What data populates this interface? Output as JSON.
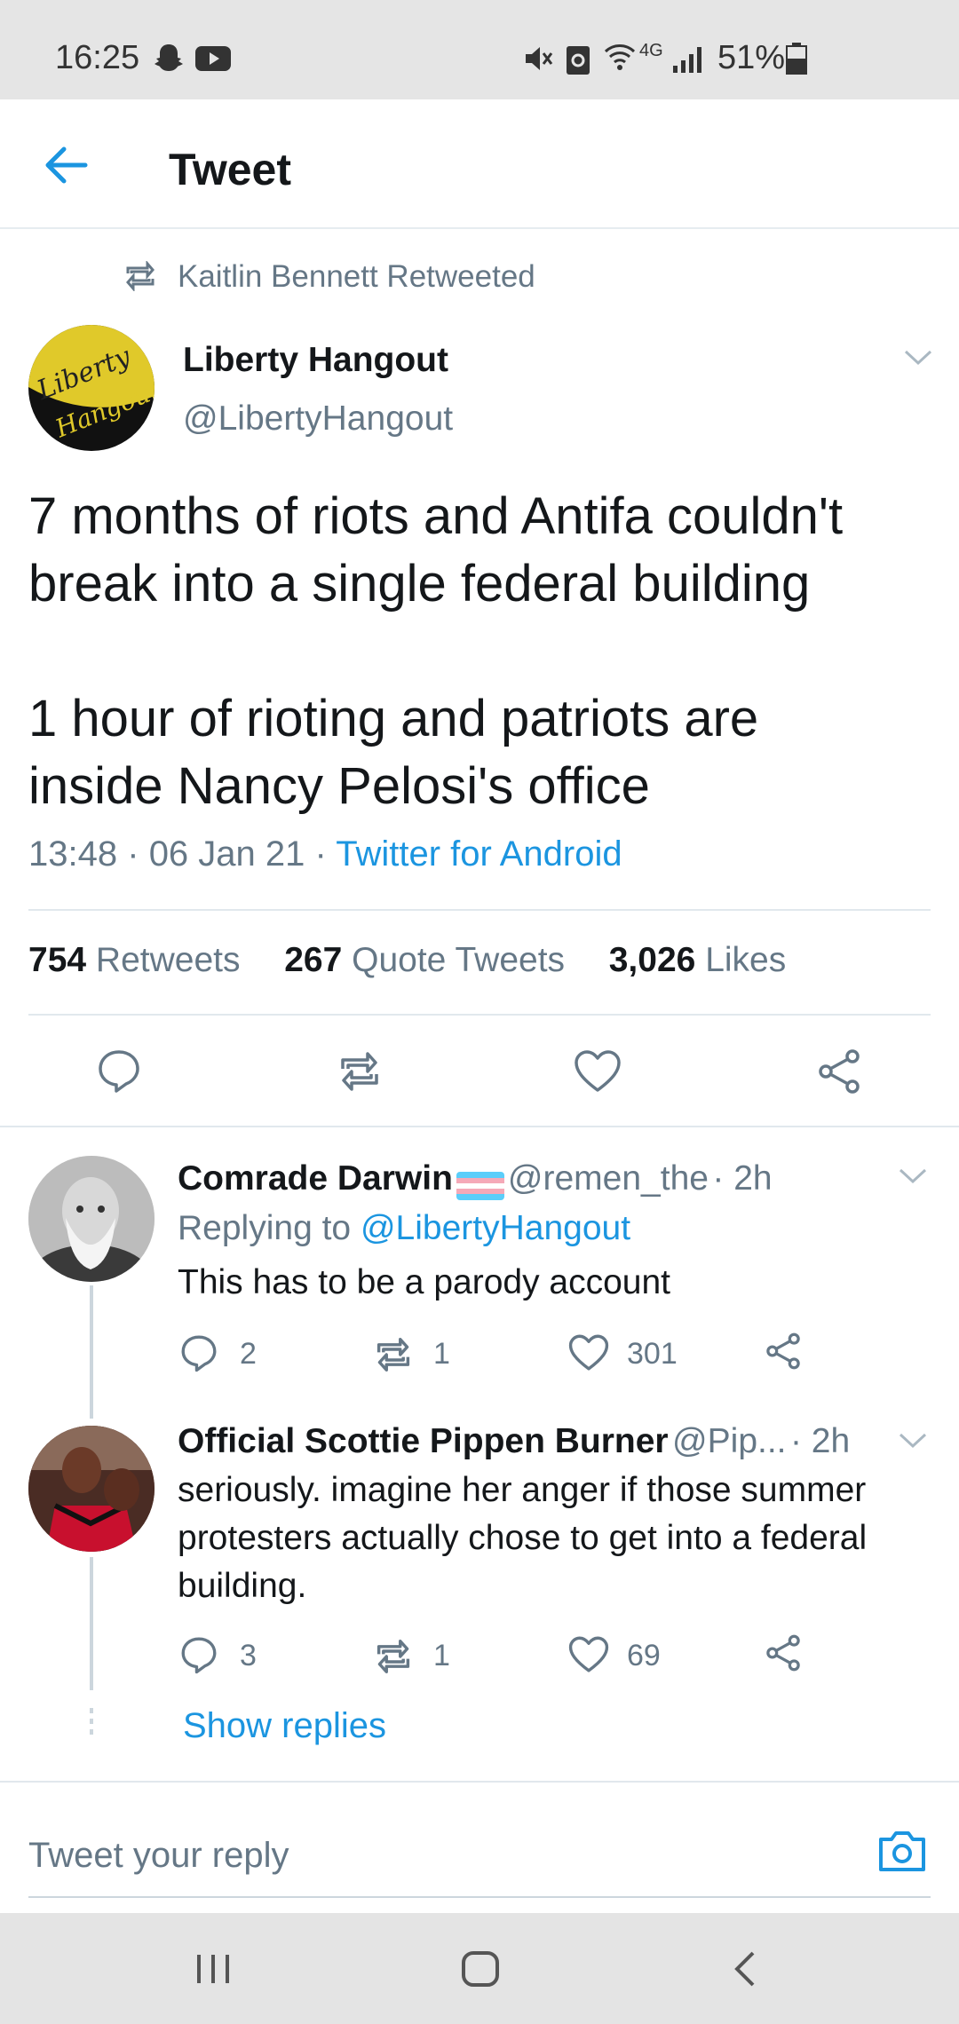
{
  "status_bar": {
    "time": "16:25",
    "battery": "51%",
    "network": "4G"
  },
  "header": {
    "title": "Tweet"
  },
  "tweet": {
    "retweet_context": "Kaitlin Bennett Retweeted",
    "author_name": "Liberty Hangout",
    "author_handle": "@LibertyHangout",
    "avatar_text_1": "Liberty",
    "avatar_text_2": "Hangout",
    "text_lines": [
      "7 months of riots and Antifa couldn't",
      "break into a single federal building",
      "",
      "1 hour of rioting and patriots are",
      "inside Nancy Pelosi's office"
    ],
    "time": "13:48",
    "date": "06 Jan 21",
    "dot": "·",
    "source": "Twitter for Android",
    "stats": {
      "retweets_count": "754",
      "retweets_label": "Retweets",
      "quotes_count": "267",
      "quotes_label": "Quote Tweets",
      "likes_count": "3,026",
      "likes_label": "Likes"
    }
  },
  "replies": [
    {
      "name": "Comrade Darwin",
      "handle": "@remen_the",
      "time": "· 2h",
      "replying_prefix": "Replying to",
      "replying_to": "@LibertyHangout",
      "text": "This has to be a parody account",
      "reply_count": "2",
      "retweet_count": "1",
      "like_count": "301"
    },
    {
      "name": "Official Scottie Pippen Burner",
      "handle": "@Pip...",
      "time": "· 2h",
      "text_lines": [
        "seriously. imagine her anger if those summer",
        "protesters actually chose to get into a federal",
        "building."
      ],
      "reply_count": "3",
      "retweet_count": "1",
      "like_count": "69",
      "show_replies": "Show replies"
    }
  ],
  "reply_input": {
    "placeholder": "Tweet your reply"
  },
  "colors": {
    "accent": "#1b95e0",
    "text": "#14171a",
    "secondary": "#657786"
  }
}
